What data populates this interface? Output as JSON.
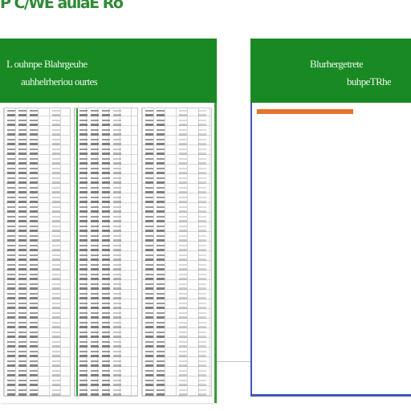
{
  "title": "P C/WE aulaE Ro",
  "left_panel": {
    "header_line1": "L ouhnpe Blahrgeuhe",
    "header_line2": "auhhelrheriou ourtes"
  },
  "right_panel": {
    "header_line1": "Blurhergetrete",
    "header_line2": "buhpeTRhe"
  },
  "colors": {
    "header_green": "#198a23",
    "title_green": "#2f8a36",
    "accent_orange": "#e8732c",
    "border_blue": "#3f55b8"
  }
}
